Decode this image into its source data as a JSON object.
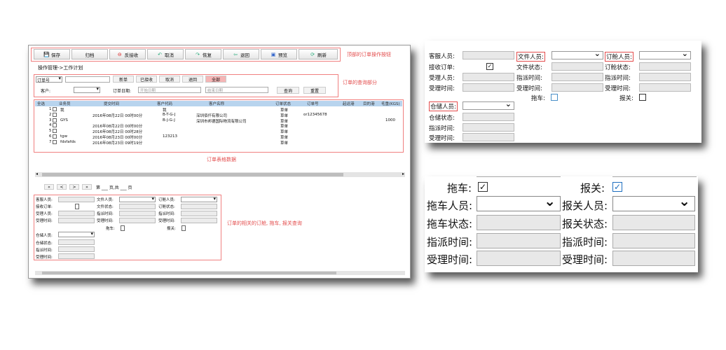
{
  "toolbar": {
    "buttons": [
      {
        "label": "保存",
        "icon": "save-icon"
      },
      {
        "label": "归档",
        "icon": ""
      },
      {
        "label": "反接收",
        "icon": "no-entry-icon"
      },
      {
        "label": "取消",
        "icon": "undo-icon"
      },
      {
        "label": "恢复",
        "icon": "redo-icon"
      },
      {
        "label": "退回",
        "icon": "return-icon"
      },
      {
        "label": "预览",
        "icon": "preview-icon"
      },
      {
        "label": "刷新",
        "icon": "refresh-icon"
      }
    ],
    "annotation": "顶部的订单操作按钮"
  },
  "breadcrumb": "操作管理->工作计划",
  "query": {
    "order_select": "订单号",
    "buttons": [
      "新单",
      "已接收",
      "取消",
      "退回",
      "全部"
    ],
    "customer_label": "客户:",
    "order_date_label": "订单日期:",
    "start_placeholder": "开始日期",
    "end_placeholder": "结束日期",
    "search": "查询",
    "reset": "重置",
    "annotation": "订单的查询部分"
  },
  "table": {
    "headers": [
      "全选",
      "业务员",
      "提交时间",
      "客户代码",
      "客户名称",
      "订单状态",
      "订单号",
      "起运港",
      "目的港",
      "毛重(KGS)"
    ],
    "rows": [
      {
        "no": "1",
        "sales": "我",
        "time": "",
        "code": "我",
        "name": "",
        "status": "草单",
        "order": "",
        "weight": ""
      },
      {
        "no": "2",
        "sales": "",
        "time": "2016年08月22日 00时00分",
        "code": "B-T-G-J",
        "name": "深圳佰仟有限公司",
        "status": "草单",
        "order": "or12345678",
        "weight": ""
      },
      {
        "no": "3",
        "sales": "GYS",
        "time": "",
        "code": "B-J-G-J",
        "name": "深圳市邦德国际物流有限公司",
        "status": "草单",
        "order": "",
        "weight": "1000"
      },
      {
        "no": "4",
        "sales": "",
        "time": "2016年08月22日 00时00分",
        "code": "",
        "name": "",
        "status": "草单",
        "order": "",
        "weight": ""
      },
      {
        "no": "5",
        "sales": "",
        "time": "2016年08月22日 00时28分",
        "code": "",
        "name": "",
        "status": "草单",
        "order": "",
        "weight": ""
      },
      {
        "no": "6",
        "sales": "tgw",
        "time": "2016年08月23日 00时00分",
        "code": "123213",
        "name": "",
        "status": "草单",
        "order": "",
        "weight": ""
      },
      {
        "no": "7",
        "sales": "fdsfafds",
        "time": "2016年08月23日 09时19分",
        "code": "",
        "name": "",
        "status": "草单",
        "order": "",
        "weight": ""
      }
    ],
    "annotation": "订单表格数据"
  },
  "pager": {
    "first": "«",
    "prev": "<",
    "next": ">",
    "last": "»",
    "text": "第 ___ 页,共 ___ 页"
  },
  "related": {
    "labels": {
      "customer_service": "客服人员:",
      "doc_person": "文件人员:",
      "booking_person": "订舱人员:",
      "receive_order": "接收订单:",
      "doc_status": "文件状态:",
      "booking_status": "订舱状态:",
      "accept_person": "受理人员:",
      "assign_time": "指派时间:",
      "accept_time": "受理时间:",
      "truck": "拖车:",
      "customs": "报关:",
      "warehouse_person": "仓储人员:",
      "warehouse_status": "仓储状态:"
    },
    "annotation": "订单的相关的订舱, 拖车, 报关查询"
  },
  "zoom": {
    "truck": "拖车:",
    "customs": "报关:",
    "truck_person": "拖车人员:",
    "customs_person": "报关人员:",
    "truck_status": "拖车状态:",
    "customs_status": "报关状态:",
    "assign_time": "指派时间:",
    "accept_time": "受理时间:"
  },
  "colors": {
    "header_blue": "#b8d4ee",
    "annotation_red": "#e34c4c",
    "active_tab": "#f5b5b5"
  }
}
